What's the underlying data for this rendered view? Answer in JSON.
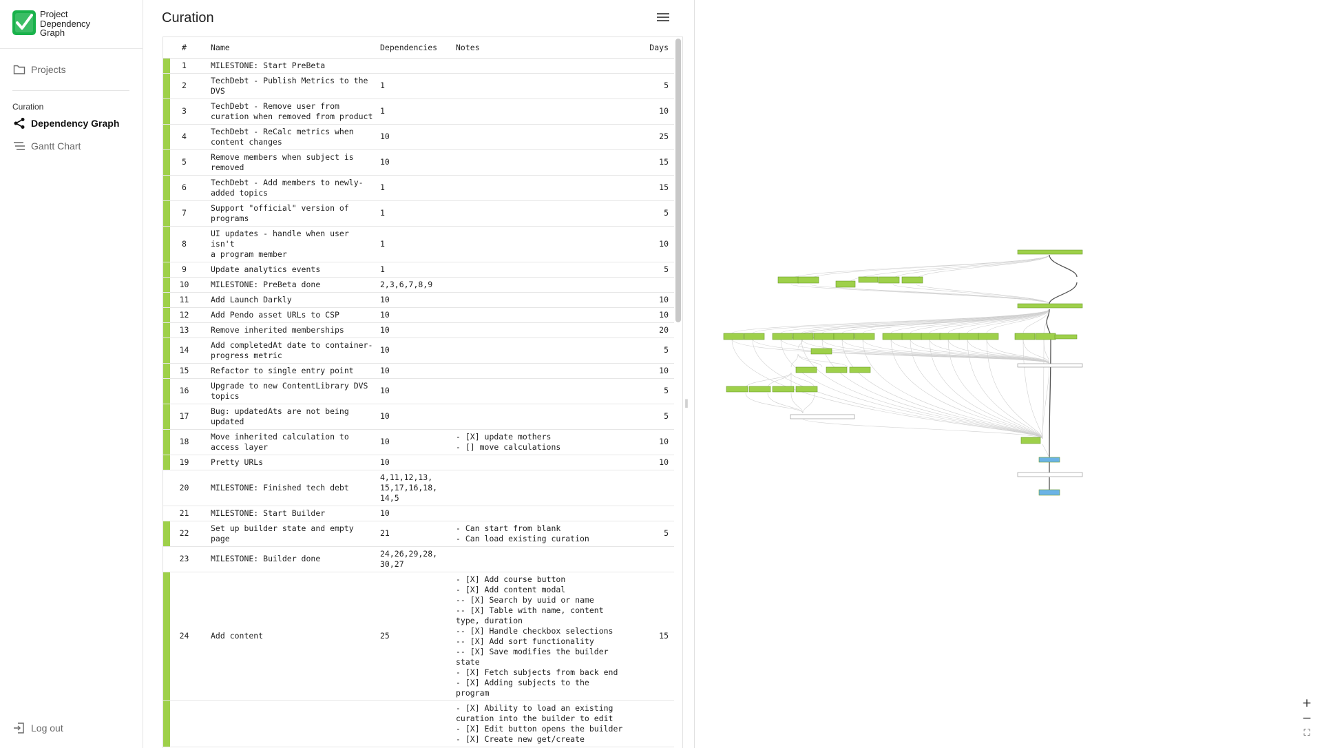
{
  "app": {
    "title_lines": [
      "Project",
      "Dependency",
      "Graph"
    ]
  },
  "sidebar": {
    "projects_label": "Projects",
    "section_label": "Curation",
    "items": [
      {
        "label": "Dependency Graph",
        "icon": "share-graph-icon",
        "active": true
      },
      {
        "label": "Gantt Chart",
        "icon": "gantt-lines-icon",
        "active": false
      }
    ],
    "logout_label": "Log out"
  },
  "main": {
    "title": "Curation",
    "columns": [
      "#",
      "Name",
      "Dependencies",
      "Notes",
      "Days"
    ],
    "rows": [
      {
        "num": "1",
        "name": "MILESTONE: Start PreBeta",
        "deps": "",
        "notes": "",
        "days": "",
        "bar": true
      },
      {
        "num": "2",
        "name": "TechDebt - Publish Metrics to the\nDVS",
        "deps": "1",
        "notes": "",
        "days": "5",
        "bar": true
      },
      {
        "num": "3",
        "name": "TechDebt - Remove user from\ncuration when removed from product",
        "deps": "1",
        "notes": "",
        "days": "10",
        "bar": true
      },
      {
        "num": "4",
        "name": "TechDebt - ReCalc metrics when\ncontent changes",
        "deps": "10",
        "notes": "",
        "days": "25",
        "bar": true
      },
      {
        "num": "5",
        "name": "Remove members when subject is\nremoved",
        "deps": "10",
        "notes": "",
        "days": "15",
        "bar": true
      },
      {
        "num": "6",
        "name": "TechDebt - Add members to newly-\nadded topics",
        "deps": "1",
        "notes": "",
        "days": "15",
        "bar": true
      },
      {
        "num": "7",
        "name": "Support \"official\" version of\nprograms",
        "deps": "1",
        "notes": "",
        "days": "5",
        "bar": true
      },
      {
        "num": "8",
        "name": "UI updates - handle when user isn't\na program member",
        "deps": "1",
        "notes": "",
        "days": "10",
        "bar": true
      },
      {
        "num": "9",
        "name": "Update analytics events",
        "deps": "1",
        "notes": "",
        "days": "5",
        "bar": true
      },
      {
        "num": "10",
        "name": "MILESTONE: PreBeta done",
        "deps": "2,3,6,7,8,9",
        "notes": "",
        "days": "",
        "bar": true
      },
      {
        "num": "11",
        "name": "Add Launch Darkly",
        "deps": "10",
        "notes": "",
        "days": "10",
        "bar": true
      },
      {
        "num": "12",
        "name": "Add Pendo asset URLs to CSP",
        "deps": "10",
        "notes": "",
        "days": "10",
        "bar": true
      },
      {
        "num": "13",
        "name": "Remove inherited memberships",
        "deps": "10",
        "notes": "",
        "days": "20",
        "bar": true
      },
      {
        "num": "14",
        "name": "Add completedAt date to container-\nprogress metric",
        "deps": "10",
        "notes": "",
        "days": "5",
        "bar": true
      },
      {
        "num": "15",
        "name": "Refactor to single entry point",
        "deps": "10",
        "notes": "",
        "days": "10",
        "bar": true
      },
      {
        "num": "16",
        "name": "Upgrade to new ContentLibrary DVS\ntopics",
        "deps": "10",
        "notes": "",
        "days": "5",
        "bar": true
      },
      {
        "num": "17",
        "name": "Bug: updatedAts are not being\nupdated",
        "deps": "10",
        "notes": "",
        "days": "5",
        "bar": true
      },
      {
        "num": "18",
        "name": "Move inherited calculation to\naccess layer",
        "deps": "10",
        "notes": "- [X] update mothers\n- [] move calculations",
        "days": "10",
        "bar": true
      },
      {
        "num": "19",
        "name": "Pretty URLs",
        "deps": "10",
        "notes": "",
        "days": "10",
        "bar": true
      },
      {
        "num": "20",
        "name": "MILESTONE: Finished tech debt",
        "deps": "4,11,12,13,\n15,17,16,18,\n14,5",
        "notes": "",
        "days": "",
        "bar": false
      },
      {
        "num": "21",
        "name": "MILESTONE: Start Builder",
        "deps": "10",
        "notes": "",
        "days": "",
        "bar": false
      },
      {
        "num": "22",
        "name": "Set up builder state and empty page",
        "deps": "21",
        "notes": "- Can start from blank\n- Can load existing curation",
        "days": "5",
        "bar": true
      },
      {
        "num": "23",
        "name": "MILESTONE: Builder done",
        "deps": "24,26,29,28,\n30,27",
        "notes": "",
        "days": "",
        "bar": false
      },
      {
        "num": "24",
        "name": "Add content",
        "deps": "25",
        "notes": "- [X] Add course button\n- [X] Add content modal\n-- [X] Search by uuid or name\n-- [X] Table with name, content\ntype, duration\n-- [X] Handle checkbox selections\n-- [X] Add sort functionality\n-- [X] Save modifies the builder\nstate\n- [X] Fetch subjects from back end\n- [X] Adding subjects to the\nprogram",
        "days": "15",
        "bar": true
      },
      {
        "num": "",
        "name": "",
        "deps": "",
        "notes": "- [X] Ability to load an existing\ncuration into the builder to edit\n- [X] Edit button opens the builder\n- [X] Create new get/create",
        "days": "",
        "bar": true
      }
    ]
  },
  "graph": {
    "green": "#9ed04a",
    "blue": "#6bb3e6",
    "white": "#ffffff",
    "zoom_in": "+",
    "zoom_out": "−",
    "fit": "⛶"
  }
}
